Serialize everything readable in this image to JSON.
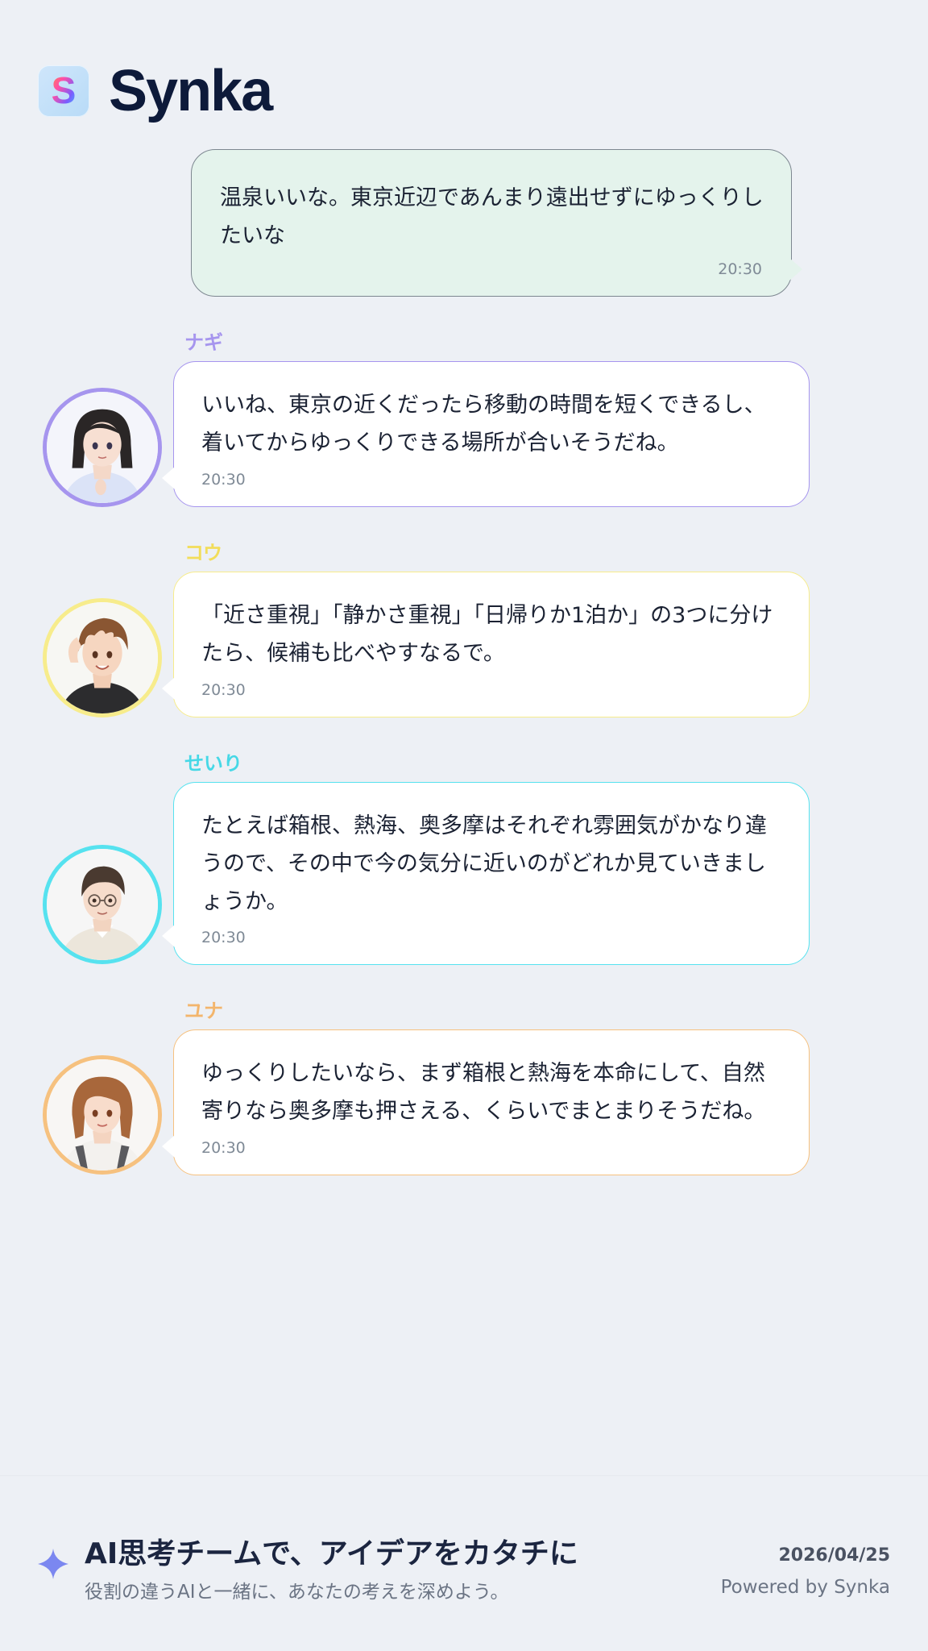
{
  "app": {
    "brand": "Synka",
    "logo_icon": "synka-s-logo-icon",
    "logo_letter": "S"
  },
  "user_message": {
    "text": "温泉いいな。東京近辺であんまり遠出せずにゆっくりしたいな",
    "time": "20:30",
    "bubble_color": "#e4f3ec"
  },
  "messages": [
    {
      "agent": "ナギ",
      "color": "#a695ee",
      "avatar_icon": "nagi-avatar-icon",
      "text": "いいね、東京の近くだったら移動の時間を短くできるし、着いてからゆっくりできる場所が合いそうだね。",
      "time": "20:30"
    },
    {
      "agent": "コウ",
      "color": "#f7ec8c",
      "avatar_icon": "kou-avatar-icon",
      "text": "「近さ重視」「静かさ重視」「日帰りか1泊か」の3つに分けたら、候補も比べやすなるで。",
      "time": "20:30"
    },
    {
      "agent": "せいり",
      "color": "#56e2ef",
      "avatar_icon": "seiri-avatar-icon",
      "text": "たとえば箱根、熱海、奥多摩はそれぞれ雰囲気がかなり違うので、その中で今の気分に近いのがどれか見ていきましょうか。",
      "time": "20:30"
    },
    {
      "agent": "ユナ",
      "color": "#f6c17f",
      "avatar_icon": "yuna-avatar-icon",
      "text": "ゆっくりしたいなら、まず箱根と熱海を本命にして、自然寄りなら奥多摩も押さえる、くらいでまとまりそうだね。",
      "time": "20:30"
    }
  ],
  "footer": {
    "title": "AI思考チームで、アイデアをカタチに",
    "subtitle": "役割の違うAIと一緒に、あなたの考えを深めよう。",
    "date": "2026/04/25",
    "powered_by": "Powered by Synka",
    "sparkle_icon": "sparkle-icon",
    "accent": "#7b87f0"
  }
}
